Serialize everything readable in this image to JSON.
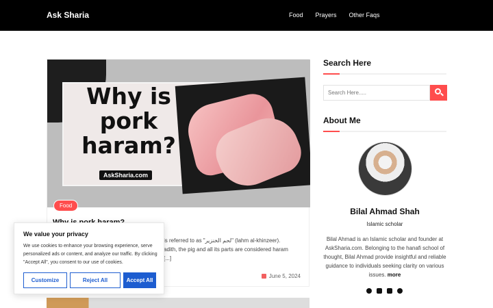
{
  "header": {
    "brand": "Ask Sharia",
    "nav": [
      "Food",
      "Prayers",
      "Other Faqs"
    ]
  },
  "post": {
    "image_title": "Why is pork haram?",
    "image_site": "AskSharia.com",
    "category": "Food",
    "title": "Why is pork haram?",
    "excerpt_lines": [
      "is referred to as \"لحم الخنزير\" (lahm al-khinzeer).",
      "adith, the pig and all its parts are considered haram",
      "[...]"
    ],
    "date": "June 5, 2024"
  },
  "sidebar": {
    "search_heading": "Search Here",
    "search_placeholder": "Search Here.....",
    "about_heading": "About Me",
    "author_name": "Bilal Ahmad Shah",
    "author_role": "Islamic scholar",
    "author_bio": "Bilal Ahmad is an Islamic scholar and founder at AskSharia.com. Belonging to the hanafi school of thought, Bilal Ahmad provide insightful and reliable guidance to individuals seeking clarity on various issues.",
    "more_label": "more",
    "socials": [
      "facebook-icon",
      "twitter-icon",
      "linkedin-icon",
      "pinterest-icon"
    ]
  },
  "cookie_banner": {
    "title": "We value your privacy",
    "text": "We use cookies to enhance your browsing experience, serve personalized ads or content, and analyze our traffic. By clicking \"Accept All\", you consent to our use of cookies.",
    "customize_label": "Customize",
    "reject_label": "Reject All",
    "accept_label": "Accept All"
  },
  "colors": {
    "accent": "#ff4d4d",
    "header_bg": "#000000",
    "cookie_blue": "#1d5dd0"
  }
}
